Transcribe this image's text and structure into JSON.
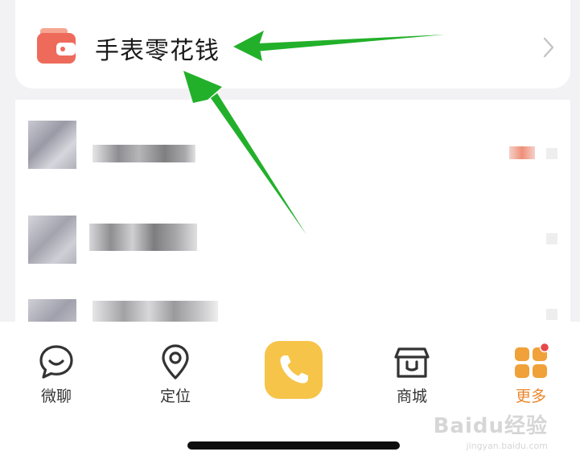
{
  "wallet_row": {
    "label": "手表零花钱",
    "icon": "wallet-icon",
    "chevron": "chevron-right-icon"
  },
  "tabbar": {
    "items": [
      {
        "label": "微聊",
        "icon": "chat-bubble-icon",
        "active": false
      },
      {
        "label": "定位",
        "icon": "location-pin-icon",
        "active": false
      },
      {
        "label": "",
        "icon": "phone-icon",
        "active": false
      },
      {
        "label": "商城",
        "icon": "shop-icon",
        "active": false
      },
      {
        "label": "更多",
        "icon": "more-grid-icon",
        "active": true
      }
    ]
  },
  "watermark": {
    "brand": "Baidu经验",
    "url": "jingyan.baidu.com"
  },
  "colors": {
    "accent_orange": "#e9862b",
    "call_button": "#f6c449",
    "arrow_green": "#22b02a",
    "wallet_red": "#ee6b5b"
  }
}
